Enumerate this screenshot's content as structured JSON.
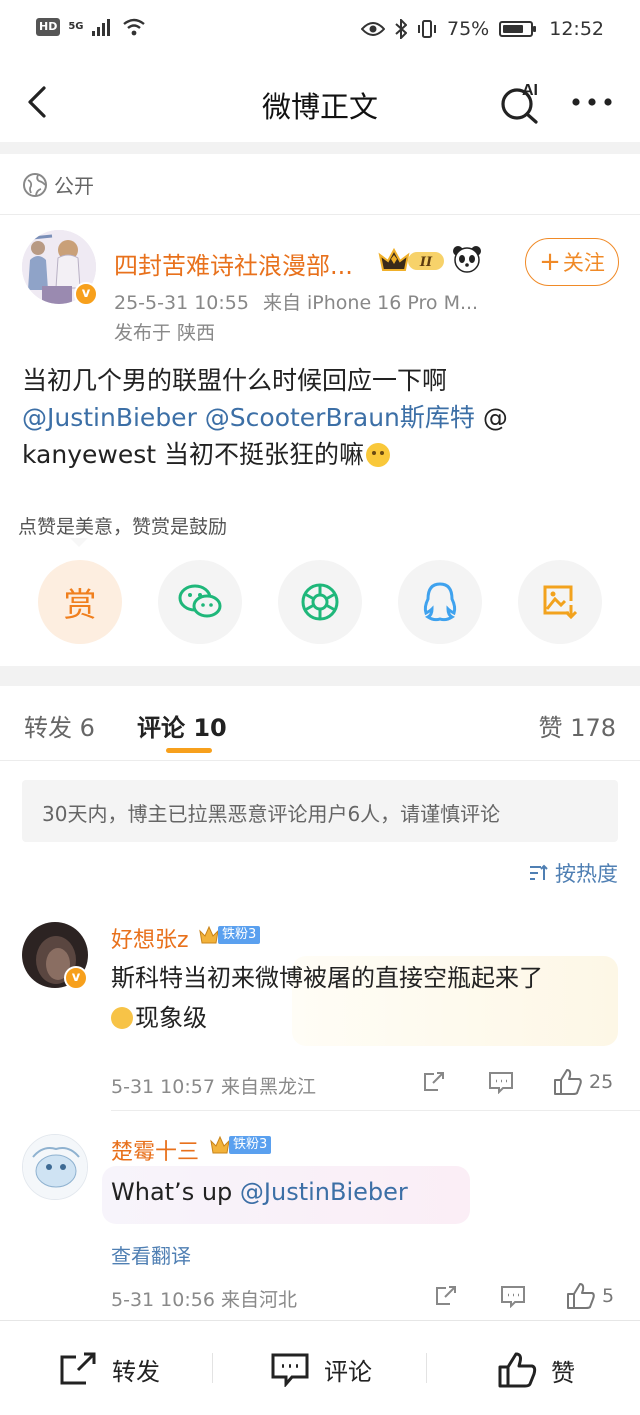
{
  "status_bar": {
    "hd": "HD",
    "network": "5G",
    "battery": "75%",
    "battery_level": 0.75,
    "time": "12:52"
  },
  "nav": {
    "title": "微博正文",
    "ai_label": "AI"
  },
  "post": {
    "visibility": "公开",
    "author": "四封苦难诗社浪漫部...",
    "vip_level": "II",
    "follow_label": "关注",
    "date": "25-5-31 10:55",
    "source": "来自 iPhone 16 Pro M...",
    "location": "发布于 陕西",
    "text_line1": "当初几个男的联盟什么时候回应一下啊",
    "mention1": "@JustinBieber",
    "mention2": "@ScooterBraun斯库特",
    "mention3": "@kanyewest",
    "text_after": "当初不挺张狂的嘛",
    "reward_tip": "点赞是美意，赞赏是鼓励",
    "reward_label": "赏"
  },
  "share_icons": [
    "reward-icon",
    "wechat-icon",
    "moments-icon",
    "qq-icon",
    "save-image-icon"
  ],
  "tabs": {
    "repost_label": "转发",
    "repost_count": "6",
    "comment_label": "评论",
    "comment_count": "10",
    "like_label": "赞",
    "like_count": "178"
  },
  "notice": "30天内，博主已拉黑恶意评论用户6人，请谨慎评论",
  "sort_label": "按热度",
  "comments": [
    {
      "name": "好想张z",
      "fan_badge": "铁粉3",
      "text_line1": "斯科特当初来微博被屠的直接空瓶起来了",
      "text_line2": "现象级",
      "date": "5-31 10:57",
      "source": "来自黑龙江",
      "likes": "25"
    },
    {
      "name": "楚霉十三",
      "fan_badge": "铁粉3",
      "text": "What’s up ",
      "mention": "@JustinBieber",
      "translate": "查看翻译",
      "date": "5-31 10:56",
      "source": "来自河北",
      "likes": "5"
    }
  ],
  "bottom_bar": {
    "repost": "转发",
    "comment": "评论",
    "like": "赞"
  },
  "colors": {
    "accent_orange": "#f08a27",
    "name_orange": "#e8711c",
    "link_blue": "#3c6fa6",
    "tab_underline": "#f7a01c",
    "fan_badge_blue": "#5aa0ef"
  }
}
